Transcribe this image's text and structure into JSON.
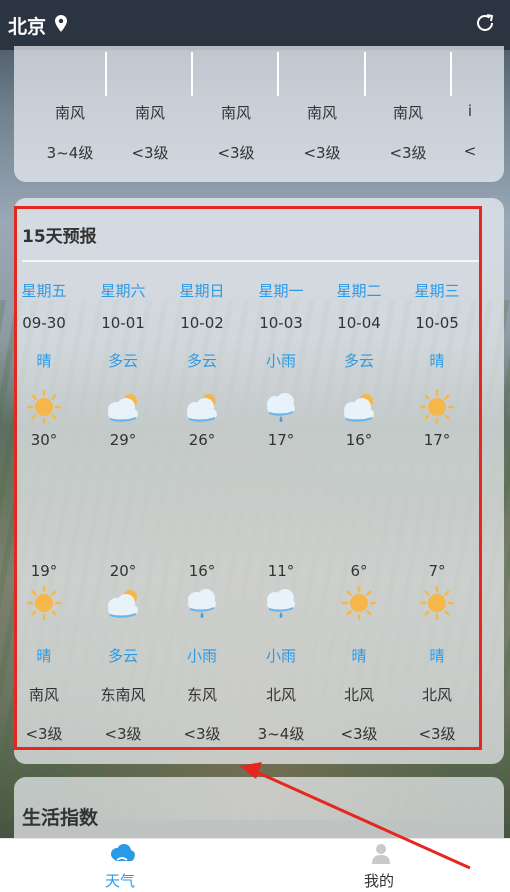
{
  "header": {
    "city": "北京"
  },
  "hourly": {
    "wind_dirs": [
      "南风",
      "南风",
      "南风",
      "南风",
      "南风",
      "i"
    ],
    "wind_levels": [
      "3~4级",
      "<3级",
      "<3级",
      "<3级",
      "<3级",
      "<"
    ]
  },
  "forecast": {
    "title": "15天预报",
    "days": [
      {
        "weekday": "星期五",
        "date": "09-30",
        "day_cond": "晴",
        "day_icon": "sun-icon",
        "high": "30°",
        "low": "19°",
        "night_icon": "sun-icon",
        "night_cond": "晴",
        "wind_dir": "南风",
        "wind_level": "<3级"
      },
      {
        "weekday": "星期六",
        "date": "10-01",
        "day_cond": "多云",
        "day_icon": "partly-cloudy-icon",
        "high": "29°",
        "low": "20°",
        "night_icon": "partly-cloudy-icon",
        "night_cond": "多云",
        "wind_dir": "东南风",
        "wind_level": "<3级"
      },
      {
        "weekday": "星期日",
        "date": "10-02",
        "day_cond": "多云",
        "day_icon": "partly-cloudy-icon",
        "high": "26°",
        "low": "16°",
        "night_icon": "light-rain-icon",
        "night_cond": "小雨",
        "wind_dir": "东风",
        "wind_level": "<3级"
      },
      {
        "weekday": "星期一",
        "date": "10-03",
        "day_cond": "小雨",
        "day_icon": "light-rain-icon",
        "high": "17°",
        "low": "11°",
        "night_icon": "light-rain-icon",
        "night_cond": "小雨",
        "wind_dir": "北风",
        "wind_level": "3~4级"
      },
      {
        "weekday": "星期二",
        "date": "10-04",
        "day_cond": "多云",
        "day_icon": "partly-cloudy-icon",
        "high": "16°",
        "low": "6°",
        "night_icon": "sun-icon",
        "night_cond": "晴",
        "wind_dir": "北风",
        "wind_level": "<3级"
      },
      {
        "weekday": "星期三",
        "date": "10-05",
        "day_cond": "晴",
        "day_icon": "sun-icon",
        "high": "17°",
        "low": "7°",
        "night_icon": "sun-icon",
        "night_cond": "晴",
        "wind_dir": "北风",
        "wind_level": "<3级"
      }
    ]
  },
  "lifestyle": {
    "title": "生活指数"
  },
  "nav": {
    "weather_label": "天气",
    "me_label": "我的"
  },
  "colors": {
    "accent": "#2b9ae6",
    "highlight": "#e5271f"
  }
}
